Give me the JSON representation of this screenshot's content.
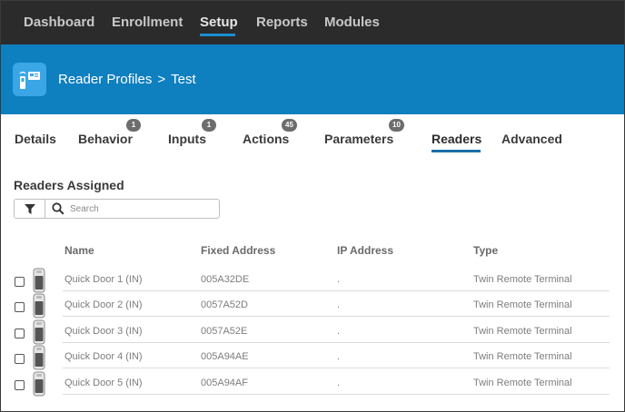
{
  "nav": {
    "items": [
      "Dashboard",
      "Enrollment",
      "Setup",
      "Reports",
      "Modules"
    ],
    "active": "Setup"
  },
  "header": {
    "crumb_parent": "Reader Profiles",
    "crumb_sep": ">",
    "crumb_current": "Test",
    "icon": "reader-profile-icon",
    "bg_color": "#0e7fbf"
  },
  "tabs": [
    {
      "label": "Details",
      "badge": ""
    },
    {
      "label": "Behavior",
      "badge": "1"
    },
    {
      "label": "Inputs",
      "badge": "1"
    },
    {
      "label": "Actions",
      "badge": "45"
    },
    {
      "label": "Parameters",
      "badge": "10"
    },
    {
      "label": "Readers",
      "badge": ""
    },
    {
      "label": "Advanced",
      "badge": ""
    }
  ],
  "active_tab": "Readers",
  "section": {
    "title": "Readers Assigned",
    "search_placeholder": "Search",
    "filter_icon": "filter-icon",
    "search_icon": "search-icon"
  },
  "table": {
    "columns": [
      "Name",
      "Fixed Address",
      "IP Address",
      "Type"
    ],
    "rows": [
      {
        "name": "Quick Door 1 (IN)",
        "fixed_address": "005A32DE",
        "ip_address": ".",
        "type": "Twin Remote Terminal"
      },
      {
        "name": "Quick Door 2 (IN)",
        "fixed_address": "0057A52D",
        "ip_address": ".",
        "type": "Twin Remote Terminal"
      },
      {
        "name": "Quick Door 3 (IN)",
        "fixed_address": "0057A52E",
        "ip_address": ".",
        "type": "Twin Remote Terminal"
      },
      {
        "name": "Quick Door 4 (IN)",
        "fixed_address": "005A94AE",
        "ip_address": ".",
        "type": "Twin Remote Terminal"
      },
      {
        "name": "Quick Door 5 (IN)",
        "fixed_address": "005A94AF",
        "ip_address": ".",
        "type": "Twin Remote Terminal"
      }
    ]
  }
}
